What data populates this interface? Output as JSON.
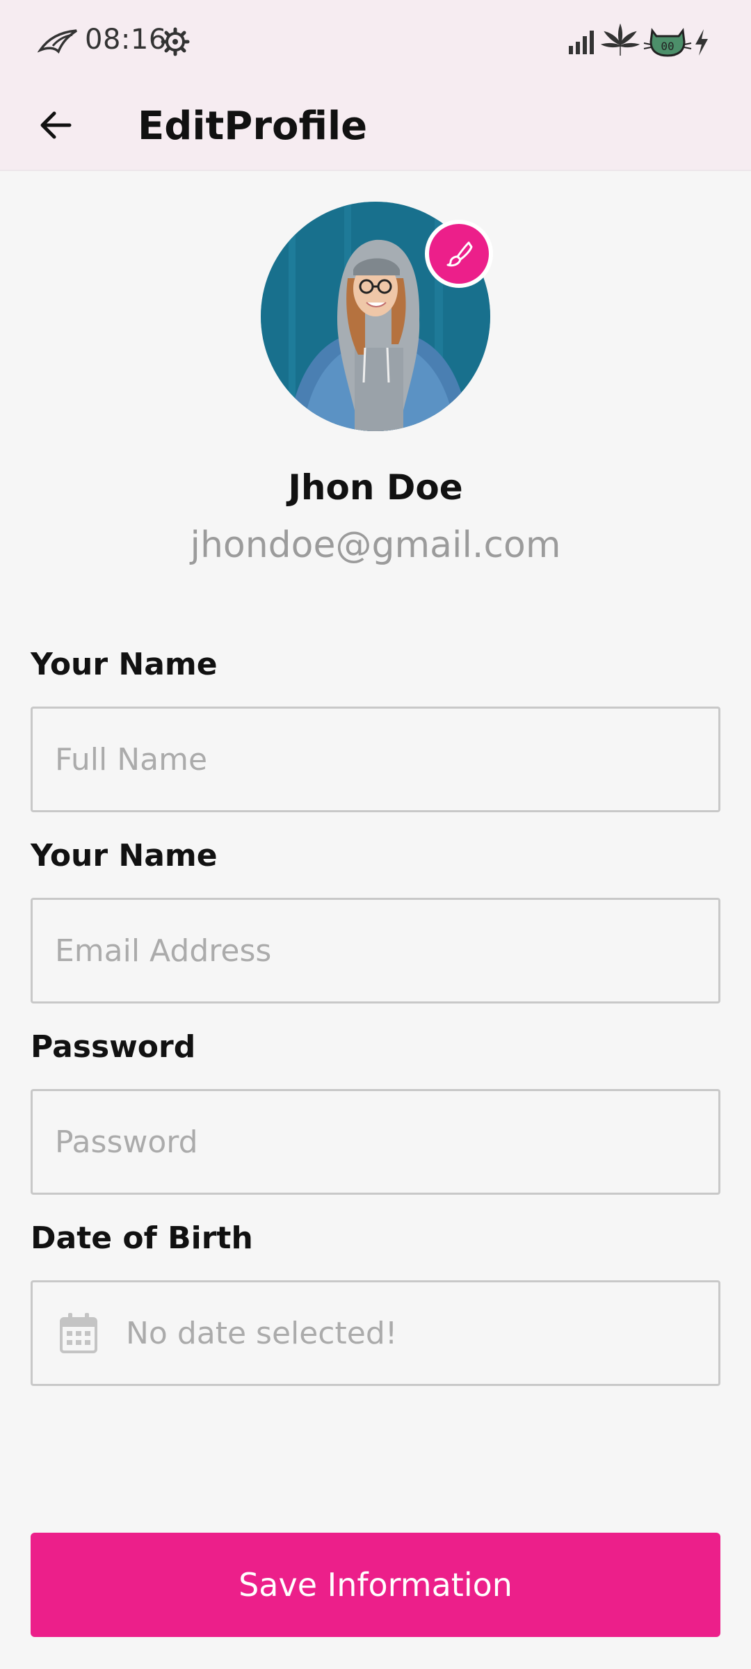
{
  "status_bar": {
    "time": "08:16",
    "icons": [
      "rog-logo-icon",
      "settings-gear-icon",
      "signal-bars-icon",
      "leaf-icon",
      "cat-battery-icon",
      "charging-bolt-icon"
    ]
  },
  "app_bar": {
    "title": "EditProfile",
    "back_icon": "arrow-back-icon"
  },
  "profile": {
    "name": "Jhon Doe",
    "email": "jhondoe@gmail.com",
    "edit_icon": "brush-icon"
  },
  "form": {
    "name_label": "Your Name",
    "name_placeholder": "Full Name",
    "email_label": "Your Name",
    "email_placeholder": "Email Address",
    "password_label": "Password",
    "password_placeholder": "Password",
    "dob_label": "Date of Birth",
    "dob_value": "No date selected!",
    "dob_icon": "calendar-icon"
  },
  "save_button": {
    "label": "Save Information"
  },
  "colors": {
    "accent": "#ec1f8a",
    "app_bar_bg": "#f6ecf1",
    "page_bg": "#f6f6f6"
  }
}
